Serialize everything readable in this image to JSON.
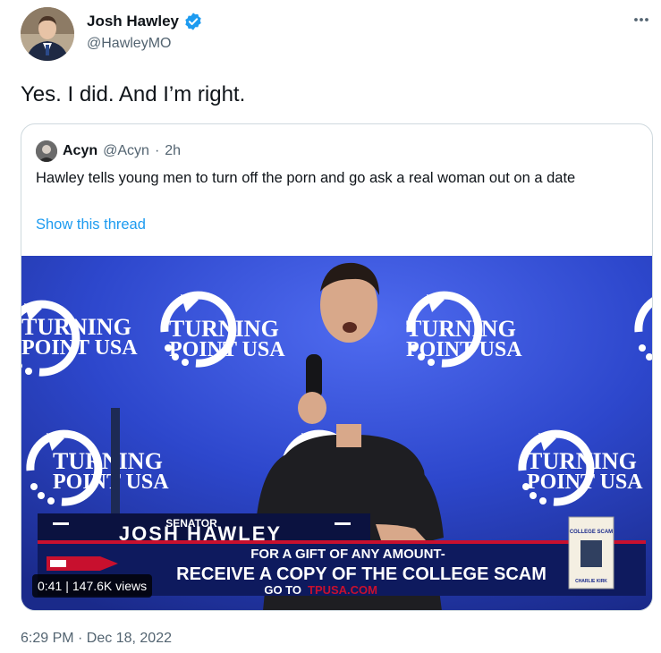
{
  "tweet": {
    "author_name": "Josh Hawley",
    "author_handle": "@HawleyMO",
    "verified_color": "#1d9bf0",
    "text": "Yes. I did. And I’m right.",
    "timestamp": "6:29 PM · Dec 18, 2022",
    "icons": {
      "verified": "verified-badge-icon",
      "more": "more-options-icon"
    }
  },
  "quote": {
    "author_name": "Acyn",
    "author_handle": "@Acyn",
    "separator": "·",
    "time_ago": "2h",
    "text": "Hawley tells young men to turn off the porn and go ask a real woman out on a date",
    "show_thread": "Show this thread",
    "link_color": "#1d9bf0"
  },
  "video": {
    "duration": "0:41",
    "views": "147.6K views",
    "backdrop_logo_text": [
      "TURNING",
      "POINT USA"
    ],
    "chyron": {
      "title": "SENATOR",
      "name": "JOSH HAWLEY",
      "line1": "FOR A GIFT OF ANY AMOUNT-",
      "line2": "RECEIVE A COPY OF THE COLLEGE SCAM",
      "line3_prefix": "GO TO",
      "line3_url": "TPUSA.COM"
    },
    "book": {
      "title": "COLLEGE SCAM",
      "author": "CHARLIE KIRK"
    }
  }
}
